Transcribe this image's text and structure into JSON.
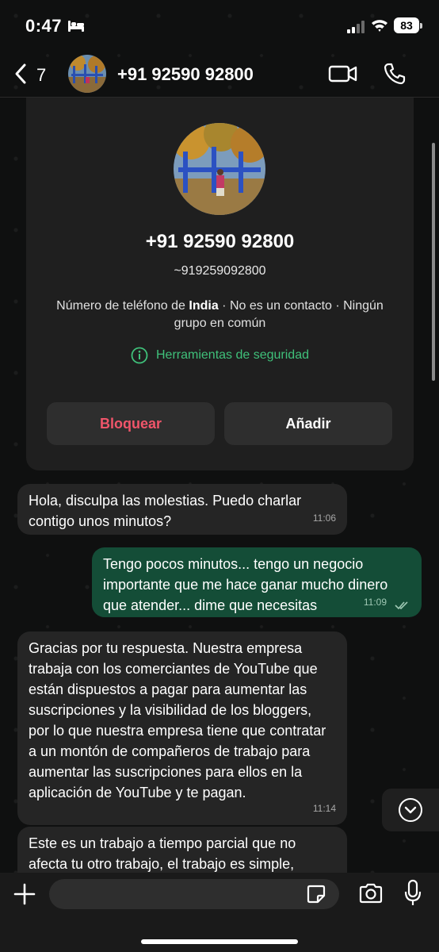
{
  "status": {
    "time": "0:47",
    "battery": "83"
  },
  "header": {
    "back_count": "7",
    "title": "+91 92590 92800"
  },
  "contact_card": {
    "name": "+91 92590 92800",
    "username": "~919259092800",
    "info_prefix": "Número de teléfono de ",
    "info_country": "India",
    "info_suffix": " · No es un contacto · Ningún grupo en común",
    "security_label": "Herramientas de seguridad",
    "block_label": "Bloquear",
    "add_label": "Añadir"
  },
  "messages": [
    {
      "direction": "in",
      "text": "Hola, disculpa las molestias. Puedo charlar contigo unos minutos?",
      "time": "11:06"
    },
    {
      "direction": "out",
      "text": "Tengo pocos minutos... tengo un negocio importante que me hace ganar mucho dinero que atender... dime que necesitas",
      "time": "11:09",
      "status": "read"
    },
    {
      "direction": "in",
      "text": "Gracias por tu respuesta. Nuestra empresa trabaja con los comerciantes de YouTube que están dispuestos a pagar para aumentar las suscripciones y la visibilidad de los bloggers, por lo que nuestra empresa tiene que contratar a un montón de compañeros de trabajo para aumentar las suscripciones para ellos en la aplicación de YouTube y te pagan.",
      "time": "11:14"
    },
    {
      "direction": "in",
      "text": "Este es un trabajo a tiempo parcial que no afecta tu otro trabajo, el trabajo es simple,"
    }
  ],
  "input": {
    "placeholder": ""
  },
  "colors": {
    "accent_green": "#3fc07a",
    "outgoing_bubble": "#144d37",
    "block_red": "#f0556a"
  }
}
